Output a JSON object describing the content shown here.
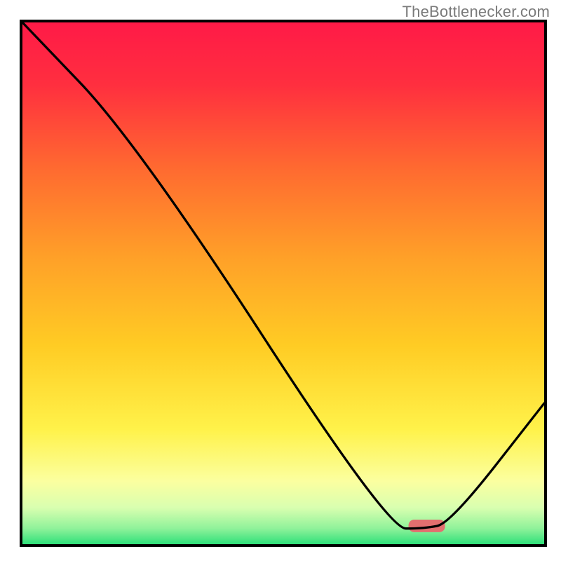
{
  "attribution": {
    "text": "TheBottlenecker.com"
  },
  "chart_data": {
    "type": "line",
    "title": "",
    "xlabel": "",
    "ylabel": "",
    "xlim": [
      0,
      100
    ],
    "ylim": [
      0,
      100
    ],
    "legend": false,
    "grid": false,
    "series": [
      {
        "name": "curve",
        "x": [
          0,
          22,
          70,
          77,
          82,
          100
        ],
        "values": [
          100,
          77,
          3,
          3,
          4,
          27
        ]
      }
    ],
    "background_gradient": {
      "type": "vertical",
      "stops": [
        {
          "pos": 0.0,
          "color": "#ff1a47"
        },
        {
          "pos": 0.12,
          "color": "#ff2f3f"
        },
        {
          "pos": 0.28,
          "color": "#ff6a30"
        },
        {
          "pos": 0.45,
          "color": "#ffa028"
        },
        {
          "pos": 0.62,
          "color": "#ffcc24"
        },
        {
          "pos": 0.78,
          "color": "#fff24a"
        },
        {
          "pos": 0.88,
          "color": "#fbffa0"
        },
        {
          "pos": 0.93,
          "color": "#d9ffb0"
        },
        {
          "pos": 0.97,
          "color": "#8ff29a"
        },
        {
          "pos": 1.0,
          "color": "#2fe07a"
        }
      ]
    },
    "marker": {
      "x": 77.5,
      "y": 3.5,
      "width": 7,
      "height": 2.4,
      "color": "#e36f6f"
    }
  }
}
